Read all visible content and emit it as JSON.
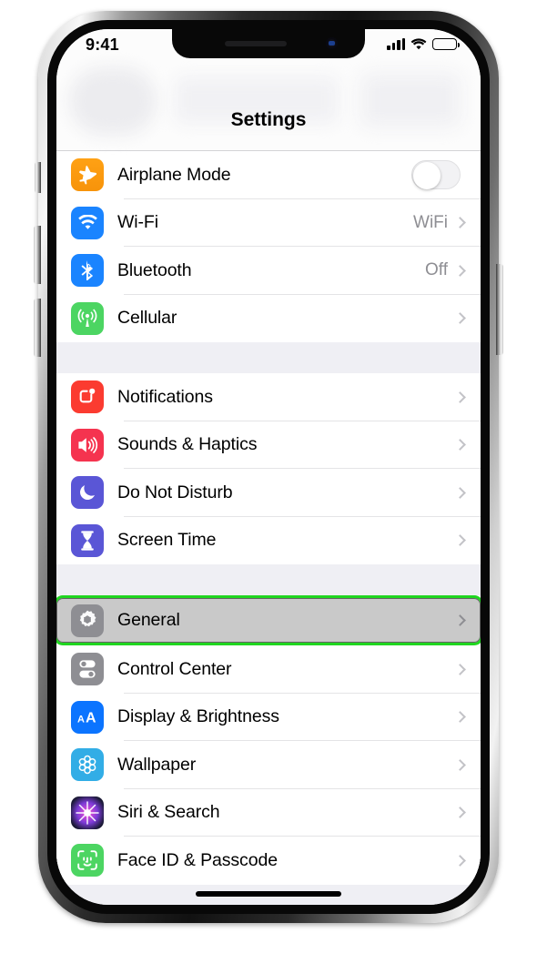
{
  "device": {
    "name": "iphone-x",
    "silent_switch": "silent-switch",
    "volume_up": "volume-up-button",
    "volume_down": "volume-down-button",
    "power": "power-button",
    "home_indicator": "home-indicator"
  },
  "status_bar": {
    "time": "9:41",
    "cellular_icon": "cellular-signal-icon",
    "wifi_icon": "wifi-icon",
    "battery_icon": "battery-icon",
    "battery_level": 100
  },
  "nav": {
    "title": "Settings"
  },
  "colors": {
    "highlight_border": "#1fd61f",
    "highlight_background": "#c9c9c9",
    "list_background": "#efeff4",
    "separator": "#e4e4e6",
    "detail_text": "#8e8e93"
  },
  "groups": [
    {
      "name": "connectivity",
      "rows": [
        {
          "label": "Airplane Mode",
          "icon": "airplane-icon",
          "icon_class": "ic-airplane",
          "accessory": "toggle",
          "toggle_on": false,
          "detail": ""
        },
        {
          "label": "Wi-Fi",
          "icon": "wifi-icon",
          "icon_class": "ic-wifi",
          "accessory": "chevron",
          "detail": "WiFi"
        },
        {
          "label": "Bluetooth",
          "icon": "bluetooth-icon",
          "icon_class": "ic-bt",
          "accessory": "chevron",
          "detail": "Off"
        },
        {
          "label": "Cellular",
          "icon": "cellular-icon",
          "icon_class": "ic-cell",
          "accessory": "chevron",
          "detail": ""
        }
      ]
    },
    {
      "name": "alerts",
      "rows": [
        {
          "label": "Notifications",
          "icon": "notifications-icon",
          "icon_class": "ic-notif",
          "accessory": "chevron",
          "detail": ""
        },
        {
          "label": "Sounds & Haptics",
          "icon": "sounds-icon",
          "icon_class": "ic-sound",
          "accessory": "chevron",
          "detail": ""
        },
        {
          "label": "Do Not Disturb",
          "icon": "moon-icon",
          "icon_class": "ic-dnd",
          "accessory": "chevron",
          "detail": ""
        },
        {
          "label": "Screen Time",
          "icon": "hourglass-icon",
          "icon_class": "ic-screen",
          "accessory": "chevron",
          "detail": ""
        }
      ]
    },
    {
      "name": "system",
      "rows": [
        {
          "label": "General",
          "icon": "gear-icon",
          "icon_class": "ic-general",
          "accessory": "chevron",
          "detail": "",
          "highlighted": true
        },
        {
          "label": "Control Center",
          "icon": "control-center-icon",
          "icon_class": "ic-control",
          "accessory": "chevron",
          "detail": ""
        },
        {
          "label": "Display & Brightness",
          "icon": "display-brightness-icon",
          "icon_class": "ic-display",
          "accessory": "chevron",
          "detail": ""
        },
        {
          "label": "Wallpaper",
          "icon": "wallpaper-icon",
          "icon_class": "ic-wall",
          "accessory": "chevron",
          "detail": ""
        },
        {
          "label": "Siri & Search",
          "icon": "siri-icon",
          "icon_class": "ic-siri",
          "accessory": "chevron",
          "detail": ""
        },
        {
          "label": "Face ID & Passcode",
          "icon": "face-id-icon",
          "icon_class": "ic-faceid",
          "accessory": "chevron",
          "detail": ""
        }
      ]
    }
  ]
}
